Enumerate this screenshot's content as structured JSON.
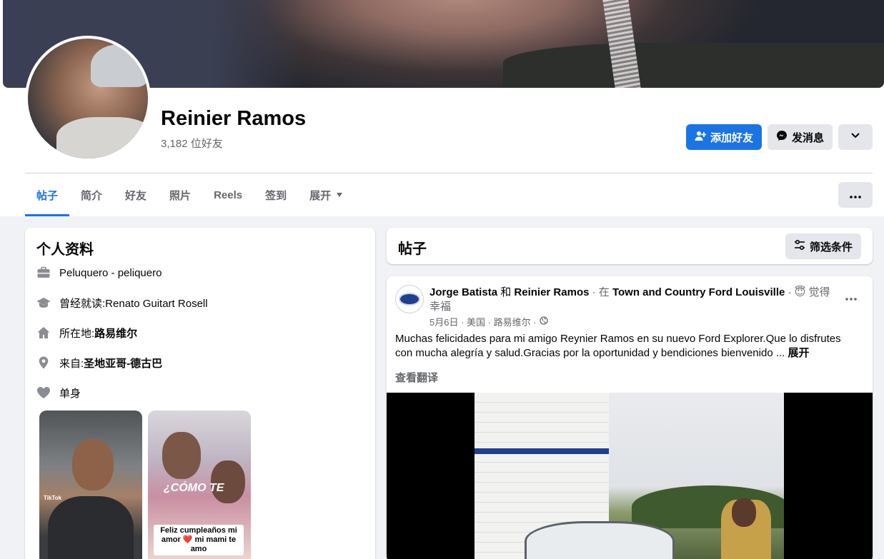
{
  "profile": {
    "name": "Reinier Ramos",
    "friends_count": "3,182 位好友",
    "add_friend_label": "添加好友",
    "message_label": "发消息"
  },
  "tabs": [
    {
      "label": "帖子",
      "active": true
    },
    {
      "label": "简介"
    },
    {
      "label": "好友"
    },
    {
      "label": "照片"
    },
    {
      "label": "Reels"
    },
    {
      "label": "签到"
    },
    {
      "label": "展开"
    }
  ],
  "intro": {
    "title": "个人资料",
    "work": "Peluquero - peliquero",
    "education_prefix": "曾经就读:",
    "education_value": "Renato Guitart Rosell",
    "lives_prefix": "所在地:",
    "lives_value": "路易维尔",
    "from_prefix": "来自:",
    "from_value": "圣地亚哥-德古巴",
    "relationship": "单身",
    "featured": [
      {
        "overlay": "TikTok"
      },
      {
        "overlay": "¿CÓMO TE",
        "caption": "Feliz cumpleaños mi amor ❤️ mi mami te amo"
      }
    ]
  },
  "posts_section": {
    "title": "帖子",
    "filter_label": "筛选条件"
  },
  "post": {
    "author": "Jorge Batista",
    "and": "和",
    "tagged": "Reinier Ramos",
    "at_prefix": "· 在",
    "place": "Town and Country Ford Louisville",
    "feeling": "· 😇 觉得幸福",
    "meta": "5月6日 · 美国 · 路易维尔 ·",
    "body": "Muchas felicidades para mi amigo Reynier Ramos en su nuevo Ford Explorer.Que lo disfrutes con mucha alegría y salud.Gracias por la oportunidad y bendiciones bienvenido ...",
    "see_more": "展开",
    "translate": "查看翻译"
  },
  "colors": {
    "accent": "#1b74e4",
    "secondary_button": "#e4e6eb",
    "background": "#f0f2f5",
    "muted_text": "#65676b"
  },
  "icons": [
    "add-friend-icon",
    "messenger-icon",
    "chevron-down-icon",
    "more-dots-icon",
    "briefcase-icon",
    "graduation-cap-icon",
    "home-icon",
    "location-pin-icon",
    "heart-icon",
    "filter-icon",
    "globe-icon"
  ]
}
